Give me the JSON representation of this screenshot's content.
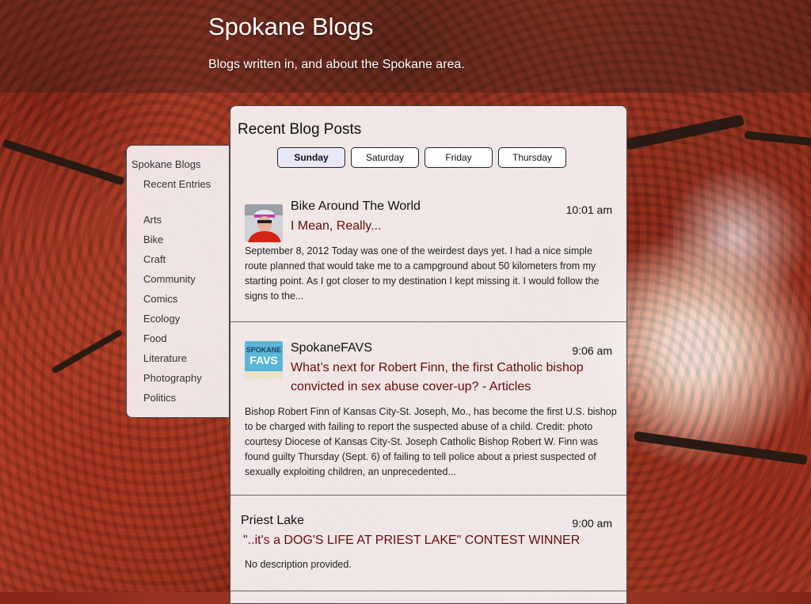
{
  "header": {
    "title": "Spokane Blogs",
    "tagline": "Blogs written in, and about the Spokane area."
  },
  "sidebar": {
    "root": "Spokane Blogs",
    "recent": "Recent Entries",
    "categories": [
      "Arts",
      "Bike",
      "Craft",
      "Community",
      "Comics",
      "Ecology",
      "Food",
      "Literature",
      "Photography",
      "Politics"
    ]
  },
  "main": {
    "title": "Recent Blog Posts",
    "days": [
      {
        "label": "Sunday",
        "active": true
      },
      {
        "label": "Saturday",
        "active": false
      },
      {
        "label": "Friday",
        "active": false
      },
      {
        "label": "Thursday",
        "active": false
      }
    ],
    "posts": [
      {
        "blog": "Bike Around The World",
        "time": "10:01 am",
        "title": "I Mean, Really...",
        "title_line2": "",
        "avatar": "cyclist-avatar",
        "desc": "September 8, 2012 Today was one of the weirdest days yet. I had a nice simple route planned that would take me to a campground about 50 kilometers from my starting point. As I got closer to my destination I kept missing it. I would follow the signs to the..."
      },
      {
        "blog": "SpokaneFAVS",
        "time": "9:06 am",
        "title": "What’s next for Robert Finn, the first Catholic bishop",
        "title_line2": "convicted in sex abuse cover-up? - Articles",
        "avatar": "spokanefavs-logo",
        "avatar_text_1": "SPOKANE",
        "avatar_text_2": "FAVS",
        "desc": "Bishop Robert Finn of Kansas City-St. Joseph, Mo., has become the first U.S. bishop to be charged with failing to report the suspected abuse of a child. Credit: photo courtesy Diocese of Kansas City-St. Joseph Catholic Bishop Robert W. Finn was found guilty Thursday (Sept. 6) of failing to tell police about a priest suspected of sexually exploiting children, an unprecedented..."
      },
      {
        "blog": "Priest Lake",
        "time": "9:00 am",
        "title": "\"..it's a DOG'S LIFE AT PRIEST LAKE\" CONTEST WINNER",
        "desc": "No description provided."
      }
    ]
  }
}
